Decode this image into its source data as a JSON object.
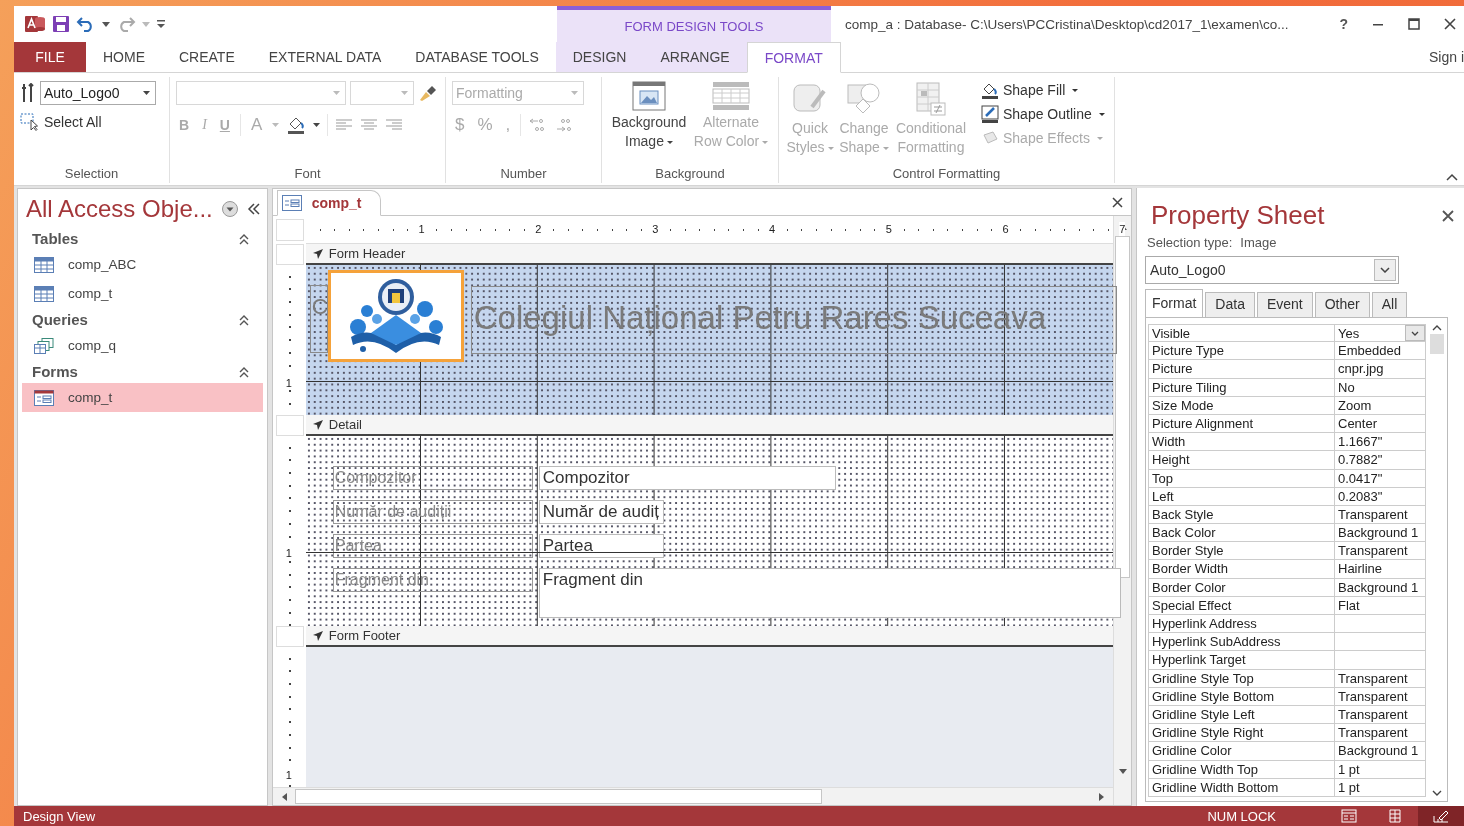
{
  "title_bar": {
    "context_tab": "FORM DESIGN TOOLS",
    "title": "comp_a : Database- C:\\Users\\PCCristina\\Desktop\\cd2017_1\\examen\\co...",
    "help": "?"
  },
  "ribbon_tabs": [
    {
      "label": "FILE",
      "kind": "file",
      "selected": false
    },
    {
      "label": "HOME",
      "kind": "tab",
      "contextual": false,
      "selected": false
    },
    {
      "label": "CREATE",
      "kind": "tab",
      "contextual": false,
      "selected": false
    },
    {
      "label": "EXTERNAL DATA",
      "kind": "tab",
      "contextual": false,
      "selected": false
    },
    {
      "label": "DATABASE TOOLS",
      "kind": "tab",
      "contextual": false,
      "selected": false
    },
    {
      "label": "DESIGN",
      "kind": "tab",
      "contextual": true,
      "selected": false
    },
    {
      "label": "ARRANGE",
      "kind": "tab",
      "contextual": true,
      "selected": false
    },
    {
      "label": "FORMAT",
      "kind": "tab",
      "contextual": true,
      "selected": true
    }
  ],
  "sign_in": "Sign i",
  "ribbon": {
    "selection": {
      "object_combo": "Auto_Logo0",
      "select_all": "Select All",
      "label": "Selection"
    },
    "font": {
      "disabled": true,
      "bold": "B",
      "italic": "I",
      "underline": "U",
      "font_color": "A",
      "label": "Font"
    },
    "number": {
      "disabled": true,
      "format_combo": "Formatting",
      "currency": "$",
      "percent": "%",
      "comma": ",",
      "label": "Number"
    },
    "background": {
      "label": "Background",
      "buttons": [
        {
          "label": "Background Image",
          "kind": "picture",
          "disabled": false
        },
        {
          "label": "Alternate Row Color",
          "kind": "rows",
          "disabled": true
        }
      ]
    },
    "control_formatting": {
      "label": "Control Formatting",
      "large": [
        {
          "label": "Quick Styles",
          "kind": "quick",
          "disabled": true
        },
        {
          "label": "Change Shape",
          "kind": "shape",
          "disabled": true
        },
        {
          "label": "Conditional Formatting",
          "kind": "conditional",
          "disabled": true
        }
      ],
      "small": [
        {
          "label": "Shape Fill",
          "kind": "fill",
          "disabled": false
        },
        {
          "label": "Shape Outline",
          "kind": "outline",
          "disabled": false
        },
        {
          "label": "Shape Effects",
          "kind": "effects",
          "disabled": true
        }
      ]
    }
  },
  "nav_pane": {
    "title": "All Access Obje...",
    "groups": [
      {
        "name": "Tables",
        "items": [
          {
            "name": "comp_ABC",
            "kind": "table",
            "selected": false
          },
          {
            "name": "comp_t",
            "kind": "table",
            "selected": false
          }
        ]
      },
      {
        "name": "Queries",
        "items": [
          {
            "name": "comp_q",
            "kind": "query",
            "selected": false
          }
        ]
      },
      {
        "name": "Forms",
        "items": [
          {
            "name": "comp_t",
            "kind": "form",
            "selected": true
          }
        ]
      }
    ]
  },
  "document": {
    "tab": "comp_t",
    "ruler": [
      "1",
      "2",
      "3",
      "4",
      "5",
      "6",
      "7"
    ],
    "sections": [
      {
        "name": "Form Header",
        "kind": "header",
        "ruler": "1"
      },
      {
        "name": "Detail",
        "kind": "detail",
        "ruler": "1"
      },
      {
        "name": "Form Footer",
        "kind": "footer",
        "ruler": "1"
      }
    ],
    "header_label_partial": "C",
    "header_title": "Colegiul Național Petru Rares Suceava",
    "detail_labels": [
      "Compozitor",
      "Număr de audiții",
      "Partea",
      "Fragment din"
    ],
    "detail_textboxes": [
      "Compozitor",
      "Număr de audiț",
      "Partea",
      "Fragment din"
    ]
  },
  "property_sheet": {
    "title": "Property Sheet",
    "selection_type_label": "Selection type:",
    "selection_type": "Image",
    "object": "Auto_Logo0",
    "tabs": [
      {
        "label": "Format",
        "selected": true
      },
      {
        "label": "Data",
        "selected": false
      },
      {
        "label": "Event",
        "selected": false
      },
      {
        "label": "Other",
        "selected": false
      },
      {
        "label": "All",
        "selected": false
      }
    ],
    "rows": [
      {
        "name": "Visible",
        "value": "Yes",
        "focused": true
      },
      {
        "name": "Picture Type",
        "value": "Embedded",
        "focused": false
      },
      {
        "name": "Picture",
        "value": "cnpr.jpg",
        "focused": false
      },
      {
        "name": "Picture Tiling",
        "value": "No",
        "focused": false
      },
      {
        "name": "Size Mode",
        "value": "Zoom",
        "focused": false
      },
      {
        "name": "Picture Alignment",
        "value": "Center",
        "focused": false
      },
      {
        "name": "Width",
        "value": "1.1667\"",
        "focused": false
      },
      {
        "name": "Height",
        "value": "0.7882\"",
        "focused": false
      },
      {
        "name": "Top",
        "value": "0.0417\"",
        "focused": false
      },
      {
        "name": "Left",
        "value": "0.2083\"",
        "focused": false
      },
      {
        "name": "Back Style",
        "value": "Transparent",
        "focused": false
      },
      {
        "name": "Back Color",
        "value": "Background 1",
        "focused": false
      },
      {
        "name": "Border Style",
        "value": "Transparent",
        "focused": false
      },
      {
        "name": "Border Width",
        "value": "Hairline",
        "focused": false
      },
      {
        "name": "Border Color",
        "value": "Background 1",
        "focused": false
      },
      {
        "name": "Special Effect",
        "value": "Flat",
        "focused": false
      },
      {
        "name": "Hyperlink Address",
        "focused": false
      },
      {
        "name": "Hyperlink SubAddress",
        "focused": false
      },
      {
        "name": "Hyperlink Target",
        "focused": false
      },
      {
        "name": "Gridline Style Top",
        "value": "Transparent",
        "focused": false
      },
      {
        "name": "Gridline Style Bottom",
        "value": "Transparent",
        "focused": false
      },
      {
        "name": "Gridline Style Left",
        "value": "Transparent",
        "focused": false
      },
      {
        "name": "Gridline Style Right",
        "value": "Transparent",
        "focused": false
      },
      {
        "name": "Gridline Color",
        "value": "Background 1",
        "focused": false
      },
      {
        "name": "Gridline Width Top",
        "value": "1 pt",
        "focused": false
      },
      {
        "name": "Gridline Width Bottom",
        "value": "1 pt",
        "focused": false
      }
    ]
  },
  "status_bar": {
    "mode": "Design View",
    "num_lock": "NUM LOCK",
    "views": [
      {
        "kind": "form",
        "selected": false
      },
      {
        "kind": "layout",
        "selected": false
      },
      {
        "kind": "design",
        "selected": true
      }
    ]
  }
}
